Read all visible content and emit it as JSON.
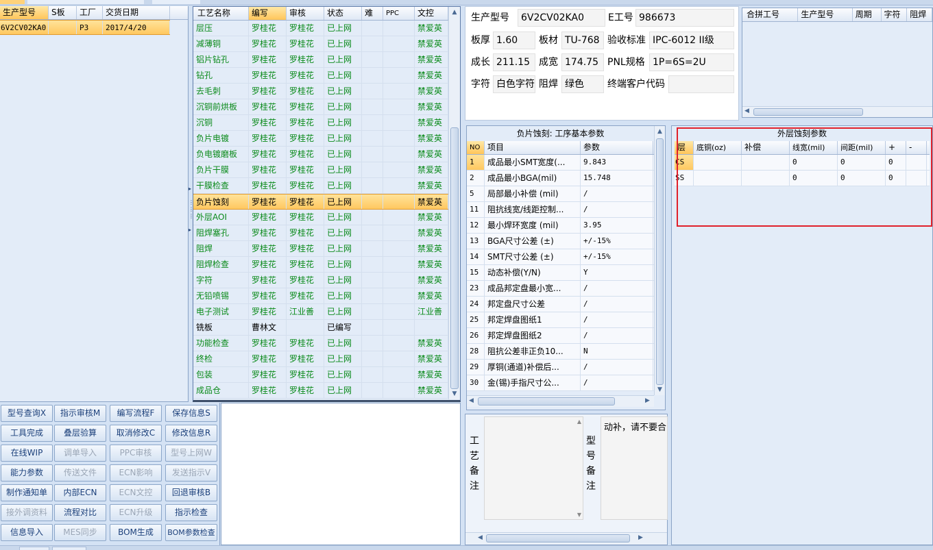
{
  "part_list": {
    "headers": [
      "生产型号",
      "S板",
      "工厂",
      "交货日期"
    ],
    "rows": [
      {
        "model": "6V2CV02KA0",
        "s_board": "",
        "factory": "P3",
        "delivery": "2017/4/20"
      }
    ]
  },
  "process_grid": {
    "headers": [
      "工艺名称",
      "编写",
      "审核",
      "状态",
      "难",
      "PPC",
      "文控"
    ],
    "rows": [
      {
        "name": "层压",
        "writer": "罗桂花",
        "reviewer": "罗桂花",
        "status": "已上网",
        "doc": "禁爱英"
      },
      {
        "name": "减薄铜",
        "writer": "罗桂花",
        "reviewer": "罗桂花",
        "status": "已上网",
        "doc": "禁爱英"
      },
      {
        "name": "铝片钻孔",
        "writer": "罗桂花",
        "reviewer": "罗桂花",
        "status": "已上网",
        "doc": "禁爱英"
      },
      {
        "name": "钻孔",
        "writer": "罗桂花",
        "reviewer": "罗桂花",
        "status": "已上网",
        "doc": "禁爱英"
      },
      {
        "name": "去毛刺",
        "writer": "罗桂花",
        "reviewer": "罗桂花",
        "status": "已上网",
        "doc": "禁爱英"
      },
      {
        "name": "沉铜前烘板",
        "writer": "罗桂花",
        "reviewer": "罗桂花",
        "status": "已上网",
        "doc": "禁爱英"
      },
      {
        "name": "沉铜",
        "writer": "罗桂花",
        "reviewer": "罗桂花",
        "status": "已上网",
        "doc": "禁爱英"
      },
      {
        "name": "负片电镀",
        "writer": "罗桂花",
        "reviewer": "罗桂花",
        "status": "已上网",
        "doc": "禁爱英"
      },
      {
        "name": "负电镀磨板",
        "writer": "罗桂花",
        "reviewer": "罗桂花",
        "status": "已上网",
        "doc": "禁爱英"
      },
      {
        "name": "负片干膜",
        "writer": "罗桂花",
        "reviewer": "罗桂花",
        "status": "已上网",
        "doc": "禁爱英"
      },
      {
        "name": "干膜检查",
        "writer": "罗桂花",
        "reviewer": "罗桂花",
        "status": "已上网",
        "doc": "禁爱英"
      },
      {
        "name": "负片蚀刻",
        "writer": "罗桂花",
        "reviewer": "罗桂花",
        "status": "已上网",
        "doc": "禁爱英",
        "selected": true
      },
      {
        "name": "外层AOI",
        "writer": "罗桂花",
        "reviewer": "罗桂花",
        "status": "已上网",
        "doc": "禁爱英"
      },
      {
        "name": "阻焊塞孔",
        "writer": "罗桂花",
        "reviewer": "罗桂花",
        "status": "已上网",
        "doc": "禁爱英"
      },
      {
        "name": "阻焊",
        "writer": "罗桂花",
        "reviewer": "罗桂花",
        "status": "已上网",
        "doc": "禁爱英"
      },
      {
        "name": "阻焊检查",
        "writer": "罗桂花",
        "reviewer": "罗桂花",
        "status": "已上网",
        "doc": "禁爱英"
      },
      {
        "name": "字符",
        "writer": "罗桂花",
        "reviewer": "罗桂花",
        "status": "已上网",
        "doc": "禁爱英"
      },
      {
        "name": "无铅喷锡",
        "writer": "罗桂花",
        "reviewer": "罗桂花",
        "status": "已上网",
        "doc": "禁爱英"
      },
      {
        "name": "电子测试",
        "writer": "罗桂花",
        "reviewer": "江业善",
        "status": "已上网",
        "doc": "江业善"
      },
      {
        "name": "铣板",
        "writer": "曹林文",
        "reviewer": "",
        "status": "已编写",
        "doc": "",
        "black": true
      },
      {
        "name": "功能检查",
        "writer": "罗桂花",
        "reviewer": "罗桂花",
        "status": "已上网",
        "doc": "禁爱英"
      },
      {
        "name": "终检",
        "writer": "罗桂花",
        "reviewer": "罗桂花",
        "status": "已上网",
        "doc": "禁爱英"
      },
      {
        "name": "包装",
        "writer": "罗桂花",
        "reviewer": "罗桂花",
        "status": "已上网",
        "doc": "禁爱英"
      },
      {
        "name": "成品仓",
        "writer": "罗桂花",
        "reviewer": "罗桂花",
        "status": "已上网",
        "doc": "禁爱英"
      }
    ]
  },
  "info": {
    "model_label": "生产型号",
    "model_value": "6V2CV02KA0",
    "e_label": "E工号",
    "e_value": "986673",
    "thickness_label": "板厚",
    "thickness_value": "1.60",
    "material_label": "板材",
    "material_value": "TU-768",
    "standard_label": "验收标准",
    "standard_value": "IPC-6012 II级",
    "length_label": "成长",
    "length_value": "211.15",
    "width_label": "成宽",
    "width_value": "174.75",
    "pnl_label": "PNL规格",
    "pnl_value": "1P=6S=2U",
    "char_label": "字符",
    "char_value": "白色字符",
    "mask_label": "阻焊",
    "mask_value": "绿色",
    "customer_label": "终端客户代码",
    "customer_value": ""
  },
  "merge_grid": {
    "headers": [
      "合拼工号",
      "生产型号",
      "周期",
      "字符",
      "阻焊"
    ]
  },
  "params": {
    "title": "负片蚀刻: 工序基本参数",
    "headers": [
      "NO",
      "项目",
      "参数"
    ],
    "rows": [
      {
        "no": "1",
        "item": "成品最小SMT宽度(...",
        "value": "9.843"
      },
      {
        "no": "2",
        "item": "成品最小BGA(mil)",
        "value": "15.748"
      },
      {
        "no": "5",
        "item": "局部最小补偿 (mil)",
        "value": "/"
      },
      {
        "no": "11",
        "item": "阻抗线宽/线距控制...",
        "value": "/"
      },
      {
        "no": "12",
        "item": "最小焊环宽度 (mil)",
        "value": "3.95"
      },
      {
        "no": "13",
        "item": "BGA尺寸公差 (±)",
        "value": "+/-15%"
      },
      {
        "no": "14",
        "item": "SMT尺寸公差 (±)",
        "value": "+/-15%"
      },
      {
        "no": "15",
        "item": "动态补偿(Y/N)",
        "value": "Y"
      },
      {
        "no": "23",
        "item": "成品邦定盘最小宽...",
        "value": "/"
      },
      {
        "no": "24",
        "item": "邦定盘尺寸公差",
        "value": "/"
      },
      {
        "no": "25",
        "item": "邦定焊盘图纸1",
        "value": "/"
      },
      {
        "no": "26",
        "item": "邦定焊盘图纸2",
        "value": "/"
      },
      {
        "no": "28",
        "item": "阻抗公差非正负10...",
        "value": "N"
      },
      {
        "no": "29",
        "item": "厚铜(通道)补偿后...",
        "value": "/"
      },
      {
        "no": "30",
        "item": "金(锡)手指尺寸公...",
        "value": "/"
      }
    ]
  },
  "etch": {
    "title": "外层蚀刻参数",
    "headers": [
      "层",
      "底铜(oz)",
      "补偿",
      "线宽(mil)",
      "间距(mil)",
      "+",
      "-"
    ],
    "rows": [
      {
        "layer": "CS",
        "base": "",
        "comp": "",
        "width": "0",
        "space": "0",
        "plus": "0",
        "minus": ""
      },
      {
        "layer": "SS",
        "base": "",
        "comp": "",
        "width": "0",
        "space": "0",
        "plus": "0",
        "minus": ""
      }
    ]
  },
  "notes": {
    "process_label": [
      "工",
      "艺",
      "备",
      "注"
    ],
    "model_label": [
      "型",
      "号",
      "备",
      "注"
    ],
    "model_note": "动补，请不要合"
  },
  "buttons": [
    {
      "label": "型号查询X",
      "enabled": true
    },
    {
      "label": "指示审核M",
      "enabled": true
    },
    {
      "label": "编写流程F",
      "enabled": true
    },
    {
      "label": "保存信息S",
      "enabled": true
    },
    {
      "label": "工具完成",
      "enabled": true
    },
    {
      "label": "叠层验算",
      "enabled": true
    },
    {
      "label": "取消修改C",
      "enabled": true
    },
    {
      "label": "修改信息R",
      "enabled": true
    },
    {
      "label": "在线WIP",
      "enabled": true
    },
    {
      "label": "调单导入",
      "enabled": false
    },
    {
      "label": "PPC审核",
      "enabled": false
    },
    {
      "label": "型号上网W",
      "enabled": false
    },
    {
      "label": "能力参数",
      "enabled": true
    },
    {
      "label": "传送文件",
      "enabled": false
    },
    {
      "label": "ECN影响",
      "enabled": false
    },
    {
      "label": "发送指示V",
      "enabled": false
    },
    {
      "label": "制作通知单",
      "enabled": true
    },
    {
      "label": "内部ECN",
      "enabled": true
    },
    {
      "label": "ECN文控",
      "enabled": false
    },
    {
      "label": "回退审核B",
      "enabled": true
    },
    {
      "label": "接外调资料",
      "enabled": false
    },
    {
      "label": "流程对比",
      "enabled": true
    },
    {
      "label": "ECN升级",
      "enabled": false
    },
    {
      "label": "指示检查",
      "enabled": true
    },
    {
      "label": "信息导入",
      "enabled": true
    },
    {
      "label": "MES同步",
      "enabled": false
    },
    {
      "label": "BOM生成",
      "enabled": true
    },
    {
      "label": "BOM参数检查",
      "enabled": true
    }
  ],
  "colors": {
    "accent_green": "#0a8a1a",
    "selection": "#ffc860",
    "highlight_box": "#e0202a"
  }
}
